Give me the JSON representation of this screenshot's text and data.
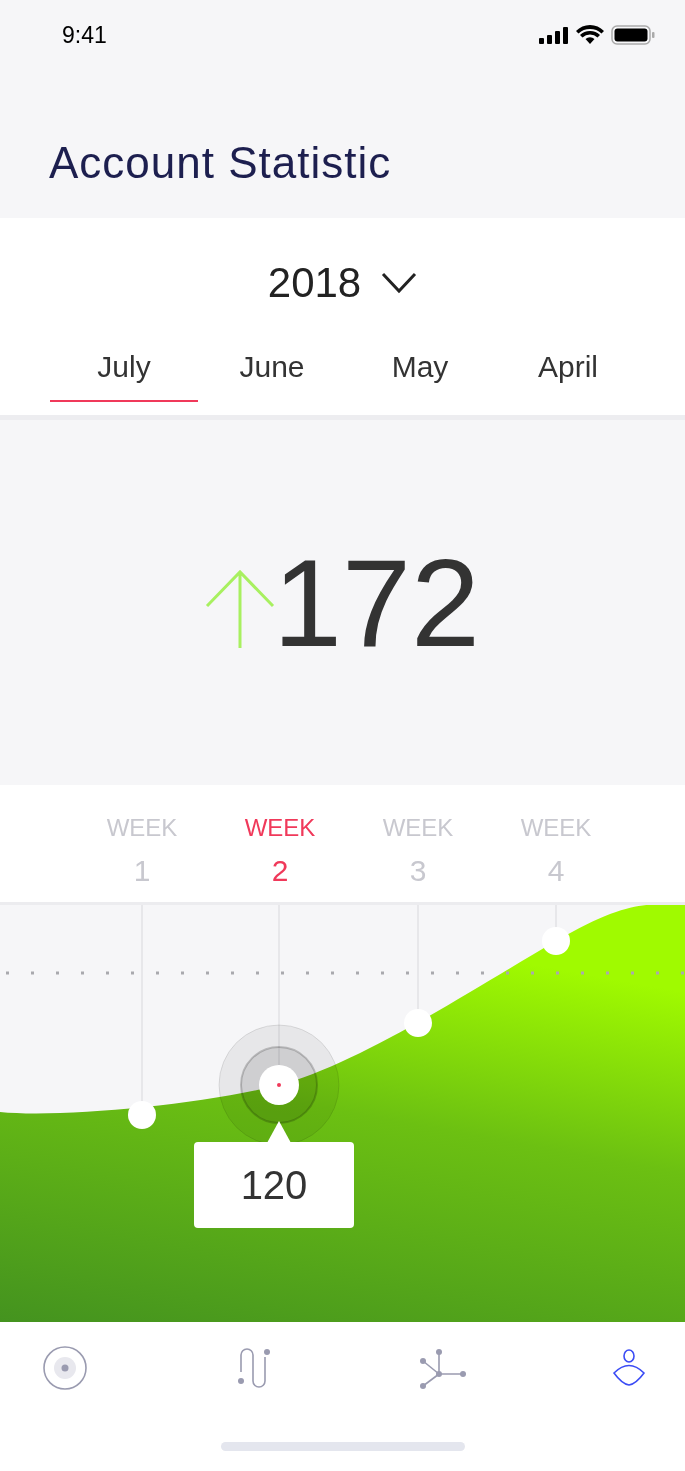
{
  "status_bar": {
    "time": "9:41"
  },
  "title": "Account Statistic",
  "year_picker": {
    "value": "2018"
  },
  "months": [
    {
      "label": "July",
      "selected": true
    },
    {
      "label": "June",
      "selected": false
    },
    {
      "label": "May",
      "selected": false
    },
    {
      "label": "April",
      "selected": false
    }
  ],
  "total": {
    "value": "172"
  },
  "weeks": [
    {
      "label": "WEEK",
      "number": "1",
      "selected": false
    },
    {
      "label": "WEEK",
      "number": "2",
      "selected": true
    },
    {
      "label": "WEEK",
      "number": "3",
      "selected": false
    },
    {
      "label": "WEEK",
      "number": "4",
      "selected": false
    }
  ],
  "tooltip": {
    "value": "120"
  },
  "nav": [
    {
      "kind": "target",
      "selected": false
    },
    {
      "kind": "path",
      "selected": false
    },
    {
      "kind": "network",
      "selected": false
    },
    {
      "kind": "profile",
      "selected": true
    }
  ]
}
